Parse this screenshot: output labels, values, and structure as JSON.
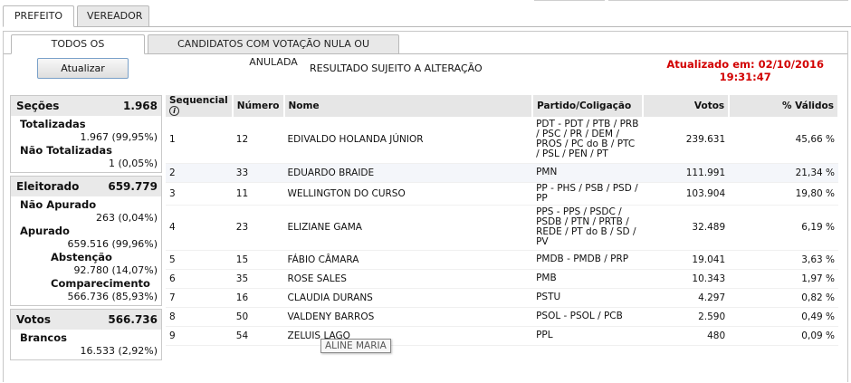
{
  "top_tabs": [
    "PREFEITO",
    "VEREADOR"
  ],
  "sub_tabs": [
    "TODOS OS CANDIDATOS",
    "CANDIDATOS COM VOTAÇÃO NULA OU ANULADA"
  ],
  "update_button": "Atualizar",
  "notice": "RESULTADO SUJEITO A ALTERAÇÃO",
  "updated_line1": "Atualizado em: 02/10/2016",
  "updated_line2": "19:31:47",
  "summary": {
    "secoes_label": "Seções",
    "secoes_value": "1.968",
    "totalizadas_label": "Totalizadas",
    "totalizadas_value": "1.967 (99,95%)",
    "nao_totalizadas_label": "Não Totalizadas",
    "nao_totalizadas_value": "1 (0,05%)",
    "eleitorado_label": "Eleitorado",
    "eleitorado_value": "659.779",
    "nao_apurado_label": "Não Apurado",
    "nao_apurado_value": "263 (0,04%)",
    "apurado_label": "Apurado",
    "apurado_value": "659.516 (99,96%)",
    "abstencao_label": "Abstenção",
    "abstencao_value": "92.780 (14,07%)",
    "comparecimento_label": "Comparecimento",
    "comparecimento_value": "566.736 (85,93%)",
    "votos_label": "Votos",
    "votos_value": "566.736",
    "brancos_label": "Brancos",
    "brancos_value": "16.533 (2,92%)"
  },
  "table": {
    "headers": [
      "Sequencial",
      "Número",
      "Nome",
      "Partido/Coligação",
      "Votos",
      "% Válidos"
    ],
    "rows": [
      {
        "seq": "1",
        "num": "12",
        "name": "EDIVALDO HOLANDA JÚNIOR",
        "party": "PDT - PDT / PTB / PRB / PSC / PR / DEM / PROS / PC do B / PTC / PSL / PEN / PT",
        "votes": "239.631",
        "pct": "45,66 %"
      },
      {
        "seq": "2",
        "num": "33",
        "name": "EDUARDO BRAIDE",
        "party": "PMN",
        "votes": "111.991",
        "pct": "21,34 %"
      },
      {
        "seq": "3",
        "num": "11",
        "name": "WELLINGTON DO CURSO",
        "party": "PP - PHS / PSB / PSD / PP",
        "votes": "103.904",
        "pct": "19,80 %"
      },
      {
        "seq": "4",
        "num": "23",
        "name": "ELIZIANE GAMA",
        "party": "PPS - PPS / PSDC / PSDB / PTN / PRTB / REDE / PT do B / SD / PV",
        "votes": "32.489",
        "pct": "6,19 %"
      },
      {
        "seq": "5",
        "num": "15",
        "name": "FÁBIO CÂMARA",
        "party": "PMDB - PMDB / PRP",
        "votes": "19.041",
        "pct": "3,63 %"
      },
      {
        "seq": "6",
        "num": "35",
        "name": "ROSE SALES",
        "party": "PMB",
        "votes": "10.343",
        "pct": "1,97 %"
      },
      {
        "seq": "7",
        "num": "16",
        "name": "CLAUDIA DURANS",
        "party": "PSTU",
        "votes": "4.297",
        "pct": "0,82 %"
      },
      {
        "seq": "8",
        "num": "50",
        "name": "VALDENY BARROS",
        "party": "PSOL - PSOL / PCB",
        "votes": "2.590",
        "pct": "0,49 %"
      },
      {
        "seq": "9",
        "num": "54",
        "name": "ZELUIS LAGO",
        "party": "PPL",
        "votes": "480",
        "pct": "0,09 %"
      }
    ]
  },
  "tooltip": "ALINE MARIA",
  "colors": {
    "updated_text": "#d20000",
    "header_bg": "#e6e6e6"
  }
}
